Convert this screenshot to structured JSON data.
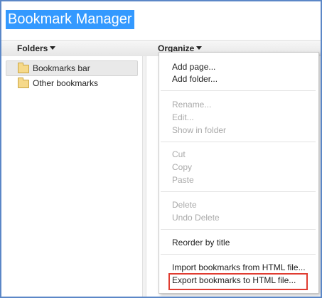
{
  "app": {
    "title": "Bookmark Manager"
  },
  "header": {
    "folders_label": "Folders",
    "organize_label": "Organize"
  },
  "folders": [
    {
      "label": "Bookmarks bar",
      "selected": true
    },
    {
      "label": "Other bookmarks",
      "selected": false
    }
  ],
  "organize_menu": {
    "groups": [
      [
        {
          "label": "Add page...",
          "enabled": true
        },
        {
          "label": "Add folder...",
          "enabled": true
        }
      ],
      [
        {
          "label": "Rename...",
          "enabled": false
        },
        {
          "label": "Edit...",
          "enabled": false
        },
        {
          "label": "Show in folder",
          "enabled": false
        }
      ],
      [
        {
          "label": "Cut",
          "enabled": false
        },
        {
          "label": "Copy",
          "enabled": false
        },
        {
          "label": "Paste",
          "enabled": false
        }
      ],
      [
        {
          "label": "Delete",
          "enabled": false
        },
        {
          "label": "Undo Delete",
          "enabled": false
        }
      ],
      [
        {
          "label": "Reorder by title",
          "enabled": true
        }
      ],
      [
        {
          "label": "Import bookmarks from HTML file...",
          "enabled": true
        },
        {
          "label": "Export bookmarks to HTML file...",
          "enabled": true,
          "highlighted": true
        }
      ]
    ]
  },
  "colors": {
    "frame_border": "#5b87c7",
    "title_highlight": "#3399ff",
    "highlight_box": "#e03c31",
    "disabled_text": "#a9a9a9"
  },
  "icons": {
    "header_caret": "caret-down-icon",
    "folder": "folder-icon"
  }
}
